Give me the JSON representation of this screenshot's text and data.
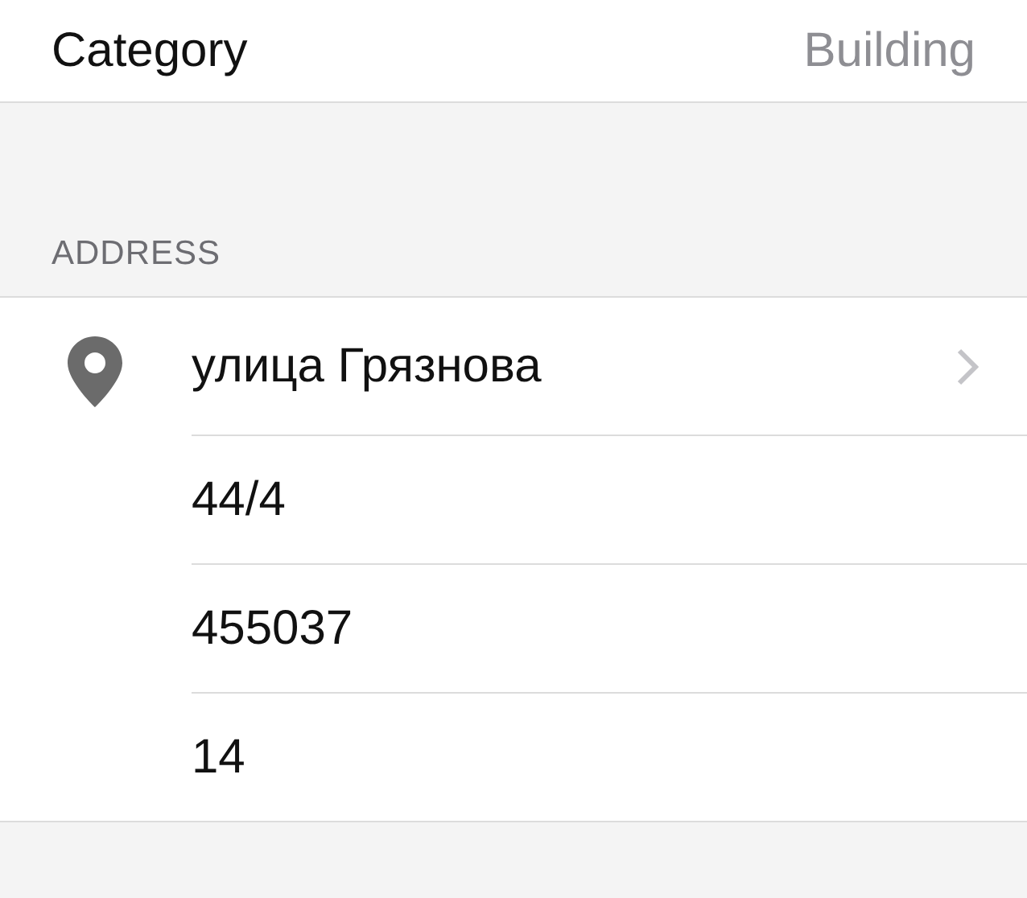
{
  "category": {
    "label": "Category",
    "value": "Building"
  },
  "address": {
    "header": "ADDRESS",
    "rows": [
      {
        "kind": "link",
        "text": "улица Грязнова"
      },
      {
        "kind": "plain",
        "text": "44/4"
      },
      {
        "kind": "plain",
        "text": "455037"
      },
      {
        "kind": "plain",
        "text": "14"
      }
    ]
  }
}
